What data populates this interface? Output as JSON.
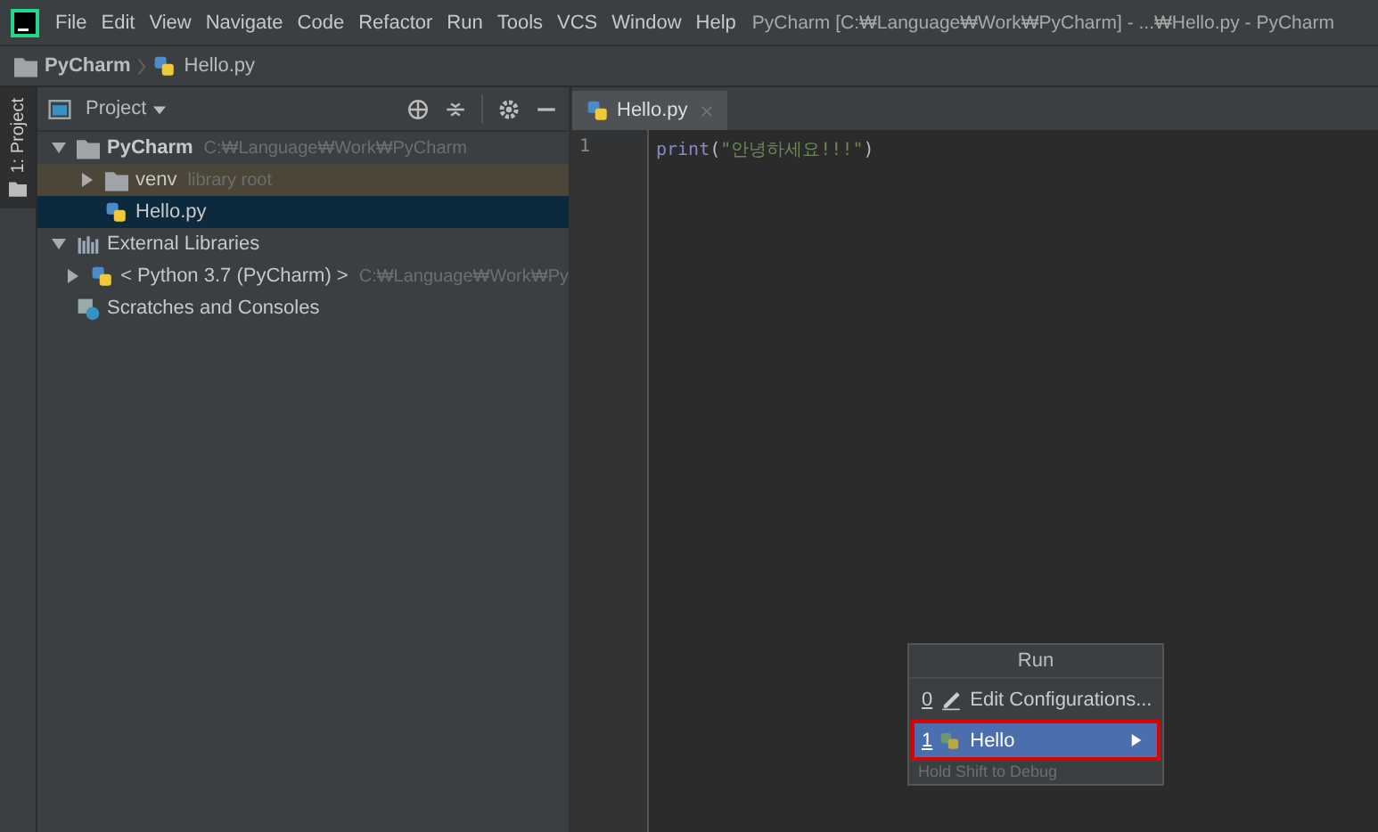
{
  "menu_bar": {
    "items": [
      "File",
      "Edit",
      "View",
      "Navigate",
      "Code",
      "Refactor",
      "Run",
      "Tools",
      "VCS",
      "Window",
      "Help"
    ],
    "title": "PyCharm [C:₩Language₩Work₩PyCharm] - ...₩Hello.py - PyCharm"
  },
  "breadcrumb": [
    "PyCharm",
    "Hello.py"
  ],
  "side_strip": {
    "tab": "1: Project"
  },
  "project_panel": {
    "title": "Project",
    "tree": [
      {
        "kind": "folder",
        "label": "PyCharm",
        "hint": "C:₩Language₩Work₩PyCharm",
        "expanded": true,
        "selected": false,
        "children": [
          {
            "kind": "venv",
            "label": "venv",
            "hint": "library root",
            "expanded": false,
            "selected": false
          },
          {
            "kind": "python",
            "label": "Hello.py",
            "selected": true
          }
        ]
      },
      {
        "kind": "libraries",
        "label": "External Libraries",
        "expanded": true,
        "selected": false,
        "children": [
          {
            "kind": "python",
            "label": "< Python 3.7 (PyCharm) >",
            "hint": "C:₩Language₩Work₩Py",
            "expanded": false,
            "selected": false
          }
        ]
      },
      {
        "kind": "scratches",
        "label": "Scratches and Consoles",
        "selected": false
      }
    ]
  },
  "editor": {
    "tabs": [
      {
        "label": "Hello.py",
        "selected": true
      }
    ],
    "lines": [
      {
        "number": "1",
        "func": "print",
        "open": "(",
        "string": "\"안녕하세요!!!\"",
        "close": ")"
      }
    ]
  },
  "run_popup": {
    "title": "Run",
    "items": [
      {
        "key": "0",
        "kind": "edit",
        "label": "Edit Configurations...",
        "selected": false,
        "annotated": false
      },
      {
        "key": "1",
        "kind": "python",
        "label": "Hello",
        "selected": true,
        "annotated": true
      }
    ],
    "footer": "Hold Shift to Debug"
  }
}
